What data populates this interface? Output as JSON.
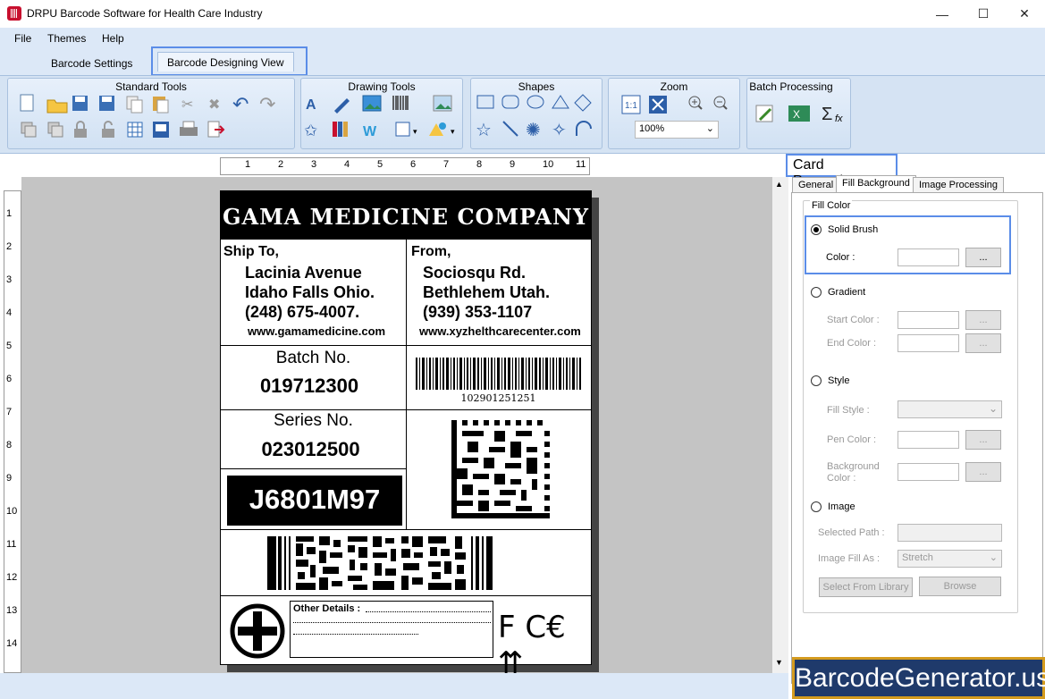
{
  "window": {
    "title": "DRPU Barcode Software for Health Care Industry",
    "minimize": "—",
    "maximize": "☐",
    "close": "✕"
  },
  "menu": {
    "items": [
      "File",
      "Themes",
      "Help"
    ]
  },
  "tabs": {
    "settings": "Barcode Settings",
    "design": "Barcode Designing View"
  },
  "ribbon": {
    "standard": "Standard Tools",
    "drawing": "Drawing Tools",
    "shapes": "Shapes",
    "zoom": "Zoom",
    "zoom_value": "100%",
    "batch": "Batch Processing"
  },
  "ruler": {
    "h": [
      "1",
      "2",
      "3",
      "4",
      "5",
      "6",
      "7",
      "8",
      "9",
      "10",
      "11"
    ],
    "v": [
      "1",
      "2",
      "3",
      "4",
      "5",
      "6",
      "7",
      "8",
      "9",
      "10",
      "11",
      "12",
      "13",
      "14"
    ]
  },
  "label": {
    "company": "GAMA MEDICINE COMPANY",
    "ship_to": "Ship To,",
    "ship_addr1": "Lacinia Avenue",
    "ship_addr2": "Idaho Falls Ohio.",
    "ship_phone": "(248) 675-4007.",
    "ship_web": "www.gamamedicine.com",
    "from": "From,",
    "from_addr1": "Sociosqu Rd.",
    "from_addr2": "Bethlehem Utah.",
    "from_phone": "(939) 353-1107",
    "from_web": "www.xyzhelthcarecenter.com",
    "batch_title": "Batch No.",
    "batch_value": "019712300",
    "barcode_text": "102901251251",
    "series_title": "Series No.",
    "series_value": "023012500",
    "code": "J6801M97",
    "other_details": "Other Details :",
    "ce_marks": "F C€ ⇈"
  },
  "panel": {
    "title": "Card Properties",
    "tabs": [
      "General",
      "Fill Background",
      "Image Processing"
    ],
    "group": "Fill Color",
    "solid": "Solid Brush",
    "color": "Color :",
    "dots": "...",
    "gradient": "Gradient",
    "start": "Start Color :",
    "end": "End Color :",
    "style": "Style",
    "fill_style": "Fill Style :",
    "pen": "Pen Color :",
    "bg1": "Background",
    "bg2": "Color :",
    "image": "Image",
    "path": "Selected Path :",
    "fillas": "Image Fill As :",
    "fillas_value": "Stretch",
    "library": "Select From Library",
    "browse": "Browse"
  },
  "watermark": "BarcodeGenerator.us"
}
